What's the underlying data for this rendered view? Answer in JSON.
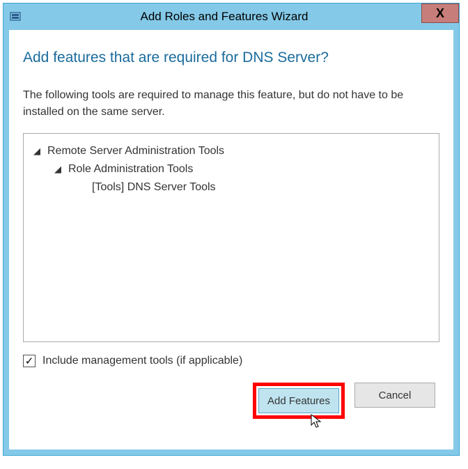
{
  "titlebar": {
    "title": "Add Roles and Features Wizard",
    "close": "X"
  },
  "heading": "Add features that are required for DNS Server?",
  "description": "The following tools are required to manage this feature, but do not have to be installed on the same server.",
  "tree": {
    "item0": "Remote Server Administration Tools",
    "item1": "Role Administration Tools",
    "item2": "[Tools] DNS Server Tools"
  },
  "checkbox": {
    "label": "Include management tools (if applicable)",
    "checkmark": "✓"
  },
  "buttons": {
    "add": "Add Features",
    "cancel": "Cancel"
  },
  "toggle_glyph": "◢"
}
